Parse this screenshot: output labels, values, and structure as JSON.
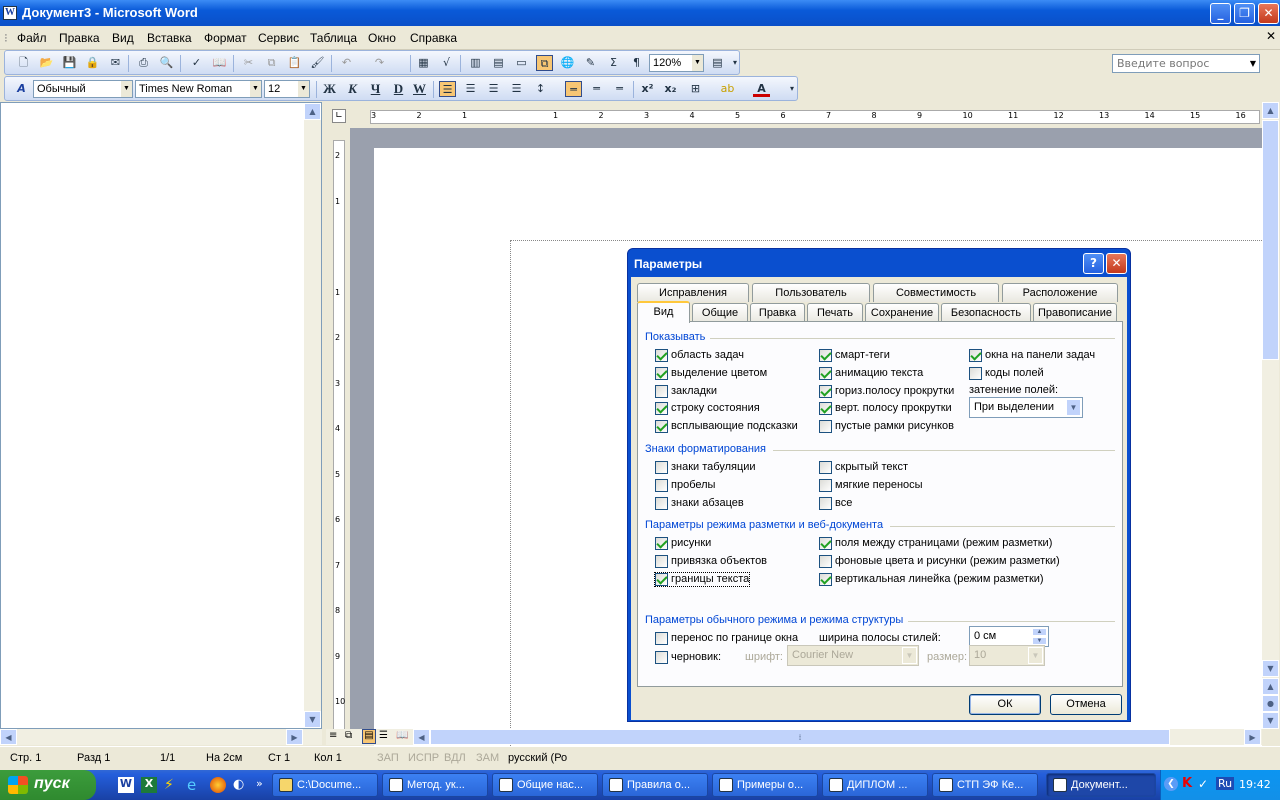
{
  "window": {
    "title": "Документ3 - Microsoft Word",
    "minimize": "_",
    "restore": "❐",
    "close": "✕"
  },
  "menu": [
    "Файл",
    "Правка",
    "Вид",
    "Вставка",
    "Формат",
    "Сервис",
    "Таблица",
    "Окно",
    "Справка"
  ],
  "ask_placeholder": "Введите вопрос",
  "toolbar": {
    "zoom": "120%",
    "style": "Обычный",
    "font": "Times New Roman",
    "size": "12",
    "bold": "Ж",
    "italic": "К",
    "underline": "Ч",
    "strike": "D",
    "w": "W",
    "superscript": "x²",
    "subscript": "x₂",
    "pilcrow": "¶",
    "sigma": "Σ"
  },
  "dialog": {
    "title": "Параметры",
    "help": "?",
    "close": "✕",
    "tabs_row1": [
      "Исправления",
      "Пользователь",
      "Совместимость",
      "Расположение"
    ],
    "tabs_row2": [
      "Вид",
      "Общие",
      "Правка",
      "Печать",
      "Сохранение",
      "Безопасность",
      "Правописание"
    ],
    "selected_tab": "Вид",
    "show": {
      "header": "Показывать",
      "col1": [
        {
          "label": "область задач",
          "checked": true
        },
        {
          "label": "выделение цветом",
          "checked": true
        },
        {
          "label": "закладки",
          "checked": false
        },
        {
          "label": "строку состояния",
          "checked": true
        },
        {
          "label": "всплывающие подсказки",
          "checked": true
        }
      ],
      "col2": [
        {
          "label": "смарт-теги",
          "checked": true
        },
        {
          "label": "анимацию текста",
          "checked": true
        },
        {
          "label": "гориз.полосу прокрутки",
          "checked": true
        },
        {
          "label": "верт. полосу прокрутки",
          "checked": true
        },
        {
          "label": "пустые рамки рисунков",
          "checked": false
        }
      ],
      "col3": [
        {
          "label": "окна на панели задач",
          "checked": true
        },
        {
          "label": "коды полей",
          "checked": false
        }
      ],
      "field_shading_label": "затенение полей:",
      "field_shading_value": "При выделении"
    },
    "format_marks": {
      "header": "Знаки форматирования",
      "col1": [
        {
          "label": "знаки табуляции",
          "checked": false
        },
        {
          "label": "пробелы",
          "checked": false
        },
        {
          "label": "знаки абзацев",
          "checked": false
        }
      ],
      "col2": [
        {
          "label": "скрытый текст",
          "checked": false
        },
        {
          "label": "мягкие переносы",
          "checked": false
        },
        {
          "label": "все",
          "checked": false
        }
      ]
    },
    "layout": {
      "header": "Параметры режима разметки и веб-документа",
      "col1": [
        {
          "label": "рисунки",
          "checked": true
        },
        {
          "label": "привязка объектов",
          "checked": false
        },
        {
          "label": "границы текста",
          "checked": true
        }
      ],
      "col2": [
        {
          "label": "поля между страницами (режим разметки)",
          "checked": true
        },
        {
          "label": "фоновые цвета и рисунки (режим разметки)",
          "checked": false
        },
        {
          "label": "вертикальная линейка (режим разметки)",
          "checked": true
        }
      ]
    },
    "normal": {
      "header": "Параметры обычного режима и режима структуры",
      "wrap": {
        "label": "перенос по границе окна",
        "checked": false
      },
      "draft": {
        "label": "черновик:",
        "checked": false
      },
      "style_width_label": "ширина полосы стилей:",
      "style_width_value": "0 см",
      "font_label": "шрифт:",
      "font_value": "Courier New",
      "size_label": "размер:",
      "size_value": "10"
    },
    "ok": "ОК",
    "cancel": "Отмена"
  },
  "ruler": {
    "h_ticks": [
      "3",
      "2",
      "1",
      "",
      "1",
      "2",
      "3",
      "4",
      "5",
      "6",
      "7",
      "8",
      "9",
      "10",
      "11",
      "12",
      "13",
      "14",
      "15",
      "16"
    ],
    "v_ticks": [
      "2",
      "1",
      "",
      "1",
      "2",
      "3",
      "4",
      "5",
      "6",
      "7",
      "8",
      "9",
      "10"
    ]
  },
  "status": {
    "page": "Стр. 1",
    "section": "Разд 1",
    "pages": "1/1",
    "at": "На 2см",
    "line": "Ст 1",
    "col": "Кол 1",
    "rec": "ЗАП",
    "trk": "ИСПР",
    "ext": "ВДЛ",
    "ovr": "ЗАМ",
    "lang": "русский (Ро"
  },
  "taskbar": {
    "start": "пуск",
    "buttons": [
      "C:\\Docume...",
      "Метод. ук...",
      "Общие нас...",
      "Правила о...",
      "Примеры о...",
      "ДИПЛОМ ...",
      "СТП ЭФ Ке...",
      "Документ..."
    ],
    "lang": "Ru",
    "time": "19:42"
  }
}
